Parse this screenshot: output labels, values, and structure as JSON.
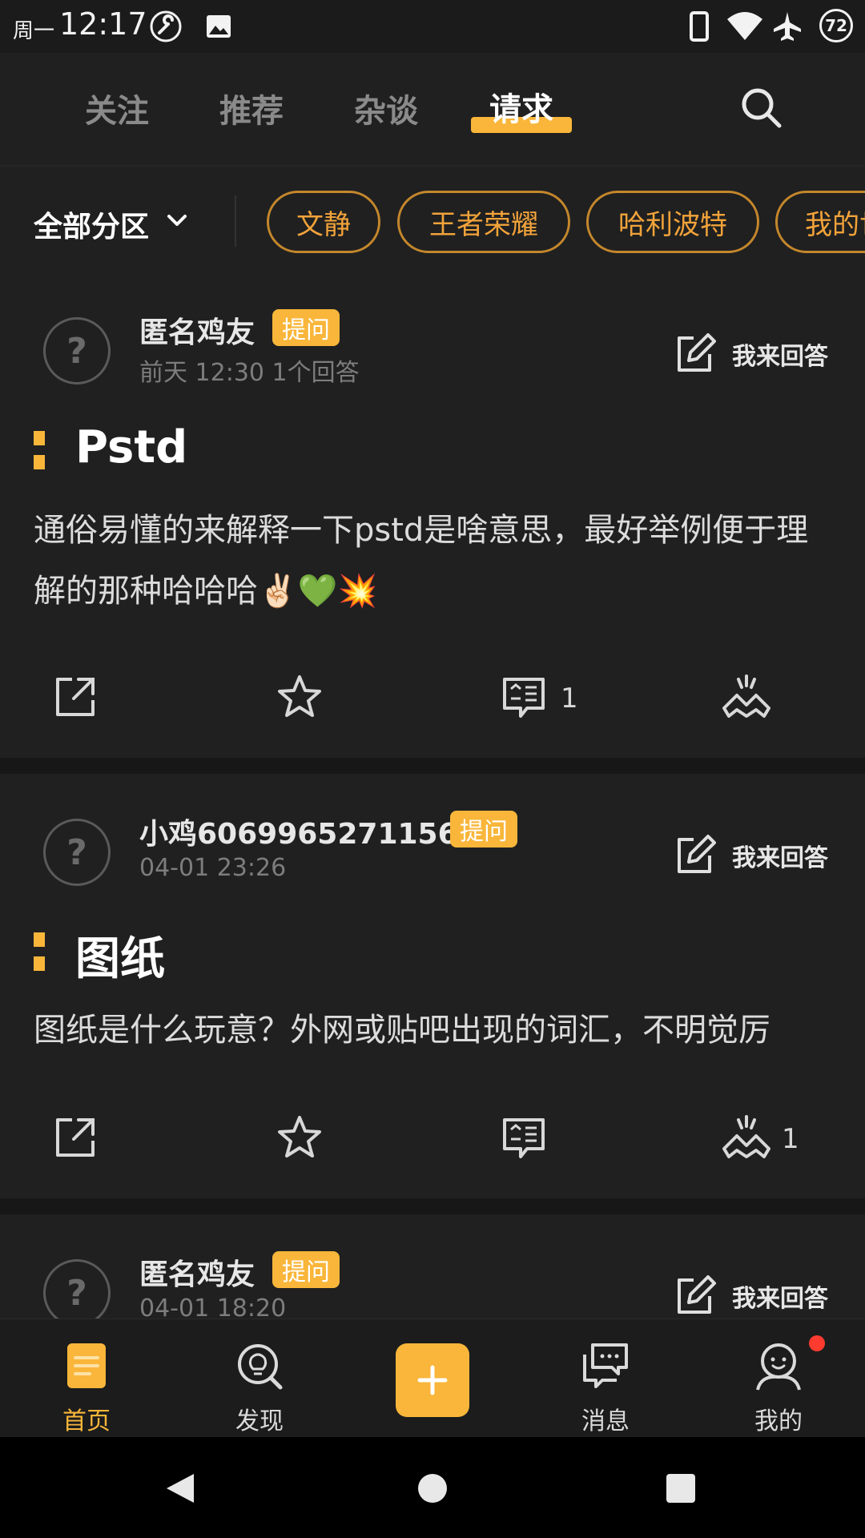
{
  "status_bar": {
    "day": "周一",
    "time": "12:17",
    "battery": "72",
    "left_icons": [
      "wrench-icon",
      "image-icon"
    ],
    "right_icons": [
      "phone-icon",
      "wifi-icon",
      "airplane-icon"
    ]
  },
  "top_tabs": {
    "items": [
      "关注",
      "推荐",
      "杂谈",
      "请求"
    ],
    "active": "请求",
    "accent": "#f9b63a"
  },
  "filter": {
    "zone_label": "全部分区",
    "chips": [
      "文静",
      "王者荣耀",
      "哈利波特",
      "我的世界"
    ]
  },
  "posts": [
    {
      "author": "匿名鸡友",
      "badge": "提问",
      "meta": "前天 12:30  1个回答",
      "answer_label": "我来回答",
      "title": "Pstd",
      "body": "通俗易懂的来解释一下pstd是啥意思，最好举例便于理解的那种哈哈哈✌🏻💚💥",
      "comment_count": "1",
      "like_count": ""
    },
    {
      "author": "小鸡6069965271156",
      "badge": "提问",
      "meta": "04-01 23:26",
      "answer_label": "我来回答",
      "title": "图纸",
      "body": "图纸是什么玩意？外网或贴吧出现的词汇，不明觉厉",
      "comment_count": "",
      "like_count": "1"
    },
    {
      "author": "匿名鸡友",
      "badge": "提问",
      "meta": "04-01 18:20",
      "answer_label": "我来回答"
    }
  ],
  "bottom_nav": {
    "items": [
      {
        "label": "首页",
        "icon": "home-doc-icon",
        "active": true
      },
      {
        "label": "发现",
        "icon": "discover-bulb-icon"
      },
      {
        "label": "",
        "icon": "plus-icon"
      },
      {
        "label": "消息",
        "icon": "message-icon"
      },
      {
        "label": "我的",
        "icon": "profile-icon"
      }
    ]
  }
}
